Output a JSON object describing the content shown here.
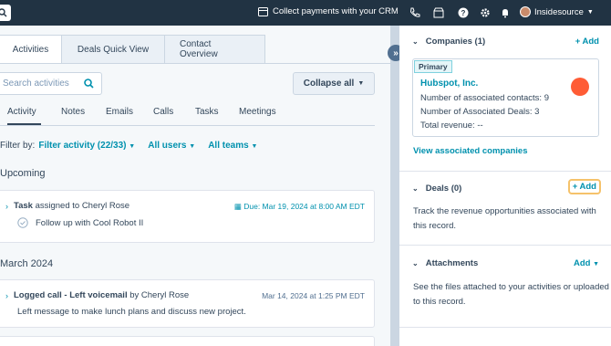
{
  "topbar": {
    "crm_label": "Collect payments with your CRM",
    "account_name": "Insidesource"
  },
  "tabs": [
    "Activities",
    "Deals Quick View",
    "Contact Overview"
  ],
  "search": {
    "placeholder": "Search activities"
  },
  "collapse_label": "Collapse all",
  "subtabs": [
    "Activity",
    "Notes",
    "Emails",
    "Calls",
    "Tasks",
    "Meetings"
  ],
  "filter": {
    "label": "Filter by:",
    "activity": "Filter activity (22/33)",
    "users": "All users",
    "teams": "All teams"
  },
  "upcoming": {
    "heading": "Upcoming",
    "task": {
      "type": "Task",
      "assigned": "assigned to Cheryl Rose",
      "due": "Due: Mar 19, 2024 at 8:00 AM EDT",
      "title": "Follow up with Cool Robot II"
    }
  },
  "month": {
    "heading": "March 2024",
    "call": {
      "type": "Logged call - Left voicemail",
      "by": "by Cheryl Rose",
      "date": "Mar 14, 2024 at 1:25 PM EDT",
      "text": "Left message to make lunch plans and discuss new project."
    }
  },
  "companies": {
    "heading": "Companies (1)",
    "add": "+ Add",
    "primary_tag": "Primary",
    "name": "Hubspot, Inc.",
    "contacts": "Number of associated contacts:  9",
    "deals": "Number of Associated Deals:  3",
    "revenue": "Total revenue:  --",
    "view_link": "View associated companies"
  },
  "deals": {
    "heading": "Deals (0)",
    "add": "+ Add",
    "text": "Track the revenue opportunities associated with this record."
  },
  "attachments": {
    "heading": "Attachments",
    "add": "Add",
    "text": "See the files attached to your activities or uploaded to this record."
  }
}
